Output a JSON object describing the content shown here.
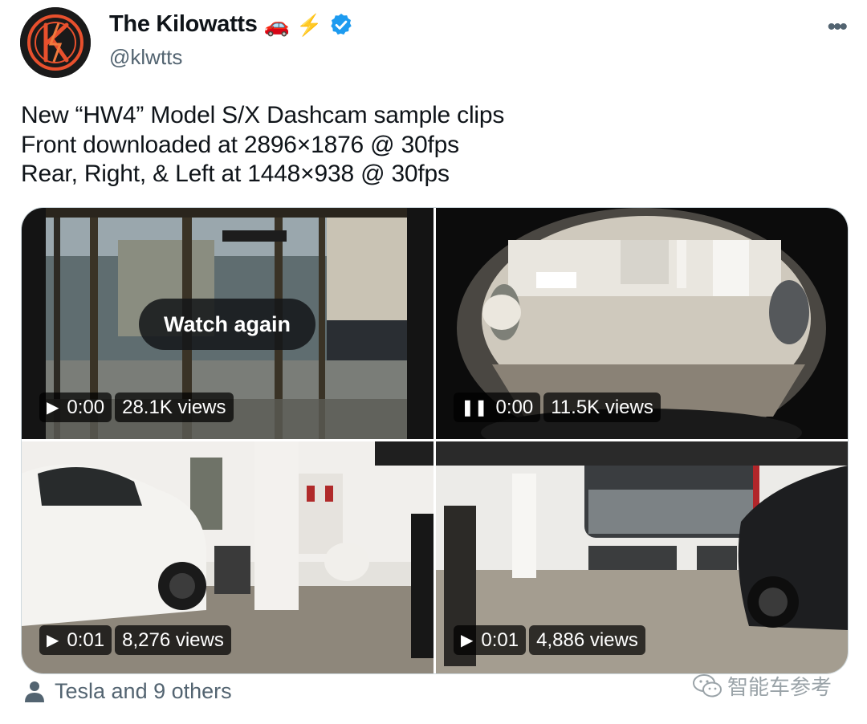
{
  "author": {
    "display_name": "The Kilowatts",
    "handle": "@klwtts",
    "emoji": [
      "🚗",
      "⚡"
    ],
    "verified": true,
    "avatar_colors": {
      "ring": "#e8502d",
      "background": "#1a1a1a"
    }
  },
  "tweet": {
    "lines": [
      "New “HW4” Model S/X Dashcam sample clips",
      "Front downloaded at 2896×1876 @ 30fps",
      "Rear, Right, & Left at 1448×938 @ 30fps"
    ]
  },
  "media": [
    {
      "state": "play",
      "state_icon": "play-icon",
      "time": "0:00",
      "views": "28.1K views",
      "overlay": "Watch again"
    },
    {
      "state": "pause",
      "state_icon": "pause-icon",
      "time": "0:00",
      "views": "11.5K views"
    },
    {
      "state": "play",
      "state_icon": "play-icon",
      "time": "0:01",
      "views": "8,276 views"
    },
    {
      "state": "play",
      "state_icon": "play-icon",
      "time": "0:01",
      "views": "4,886 views"
    }
  ],
  "footer": {
    "tagged_text": "Tesla and 9 others",
    "tagged_icon": "person-icon"
  },
  "watermark": {
    "text": "智能车参考",
    "icon": "wechat-icon"
  },
  "colors": {
    "verified_blue": "#1d9bf0",
    "secondary_text": "#536471",
    "primary_text": "#0f1419"
  }
}
